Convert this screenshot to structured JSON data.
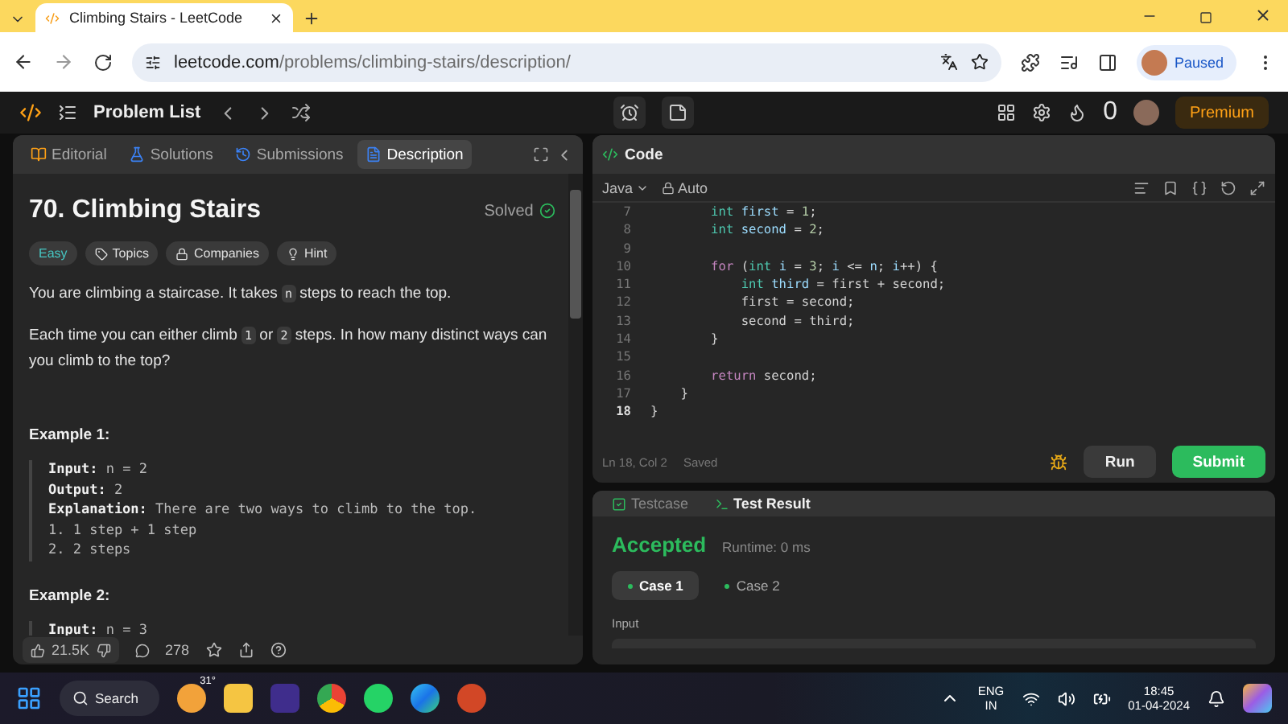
{
  "browser": {
    "tab_title": "Climbing Stairs - LeetCode",
    "url_host": "leetcode.com",
    "url_path": "/problems/climbing-stairs/description/",
    "profile": "Paused"
  },
  "nav": {
    "problem_list": "Problem List",
    "streak": "0",
    "premium": "Premium"
  },
  "left_tabs": [
    {
      "label": "Editorial",
      "selected": false
    },
    {
      "label": "Solutions",
      "selected": false
    },
    {
      "label": "Submissions",
      "selected": false
    },
    {
      "label": "Description",
      "selected": true
    }
  ],
  "problem": {
    "title": "70. Climbing Stairs",
    "status": "Solved",
    "difficulty": "Easy",
    "tags": [
      "Topics",
      "Companies",
      "Hint"
    ],
    "paragraphs": [
      [
        {
          "kind": "text",
          "text": "You are climbing a staircase. It takes "
        },
        {
          "kind": "code",
          "text": "n"
        },
        {
          "kind": "text",
          "text": " steps to reach the top."
        }
      ],
      [
        {
          "kind": "text",
          "text": "Each time you can either climb "
        },
        {
          "kind": "code",
          "text": "1"
        },
        {
          "kind": "text",
          "text": " or "
        },
        {
          "kind": "code",
          "text": "2"
        },
        {
          "kind": "text",
          "text": " steps. In how many distinct ways can you climb to the top?"
        }
      ]
    ],
    "examples": [
      {
        "title": "Example 1:",
        "lines": [
          {
            "label": "Input:",
            "value": "n = 2"
          },
          {
            "label": "Output:",
            "value": "2"
          },
          {
            "label": "Explanation:",
            "value": "There are two ways to climb to the top."
          },
          {
            "value": "1. 1 step + 1 step"
          },
          {
            "value": "2. 2 steps"
          }
        ]
      },
      {
        "title": "Example 2:",
        "lines": [
          {
            "label": "Input:",
            "value": "n = 3"
          }
        ]
      }
    ],
    "likes": "21.5K",
    "comments": "278"
  },
  "code_panel": {
    "title": "Code",
    "language": "Java",
    "mode": "Auto",
    "lines": [
      {
        "number": "7",
        "current": false,
        "segments": [
          {
            "kind": "type",
            "text": "        int"
          },
          {
            "kind": "var",
            "text": " first"
          },
          {
            "kind": "plain",
            "text": " = "
          },
          {
            "kind": "num",
            "text": "1"
          },
          {
            "kind": "plain",
            "text": ";"
          }
        ]
      },
      {
        "number": "8",
        "current": false,
        "segments": [
          {
            "kind": "type",
            "text": "        int"
          },
          {
            "kind": "var",
            "text": " second"
          },
          {
            "kind": "plain",
            "text": " = "
          },
          {
            "kind": "num",
            "text": "2"
          },
          {
            "kind": "plain",
            "text": ";"
          }
        ]
      },
      {
        "number": "9",
        "current": false
      },
      {
        "number": "10",
        "current": false,
        "segments": [
          {
            "kind": "keyword",
            "text": "        for"
          },
          {
            "kind": "plain",
            "text": " ("
          },
          {
            "kind": "type",
            "text": "int"
          },
          {
            "kind": "var",
            "text": " i"
          },
          {
            "kind": "plain",
            "text": " = "
          },
          {
            "kind": "num",
            "text": "3"
          },
          {
            "kind": "plain",
            "text": "; "
          },
          {
            "kind": "var",
            "text": "i"
          },
          {
            "kind": "plain",
            "text": " <= "
          },
          {
            "kind": "var",
            "text": "n"
          },
          {
            "kind": "plain",
            "text": "; "
          },
          {
            "kind": "var",
            "text": "i"
          },
          {
            "kind": "plain",
            "text": "++) {"
          }
        ]
      },
      {
        "number": "11",
        "current": false,
        "segments": [
          {
            "kind": "type",
            "text": "            int"
          },
          {
            "kind": "var",
            "text": " third"
          },
          {
            "kind": "plain",
            "text": " = first + second;"
          }
        ]
      },
      {
        "number": "12",
        "current": false,
        "segments": [
          {
            "kind": "plain",
            "text": "            first = second;"
          }
        ]
      },
      {
        "number": "13",
        "current": false,
        "segments": [
          {
            "kind": "plain",
            "text": "            second = third;"
          }
        ]
      },
      {
        "number": "14",
        "current": false,
        "segments": [
          {
            "kind": "plain",
            "text": "        }"
          }
        ]
      },
      {
        "number": "15",
        "current": false
      },
      {
        "number": "16",
        "current": false,
        "segments": [
          {
            "kind": "keyword",
            "text": "        return"
          },
          {
            "kind": "plain",
            "text": " second;"
          }
        ]
      },
      {
        "number": "17",
        "current": false,
        "segments": [
          {
            "kind": "plain",
            "text": "    }"
          }
        ]
      },
      {
        "number": "18",
        "current": true,
        "segments": [
          {
            "kind": "plain",
            "text": "}"
          }
        ]
      }
    ],
    "cursor": "Ln 18, Col 2",
    "save_state": "Saved",
    "run": "Run",
    "submit": "Submit"
  },
  "result_panel": {
    "tabs": [
      {
        "label": "Testcase",
        "selected": false
      },
      {
        "label": "Test Result",
        "selected": true
      }
    ],
    "verdict": "Accepted",
    "runtime": "Runtime: 0 ms",
    "cases": [
      {
        "label": "Case 1",
        "selected": true
      },
      {
        "label": "Case 2",
        "selected": false
      }
    ],
    "input_label": "Input"
  },
  "taskbar": {
    "search": "Search",
    "temperature": "31°",
    "language": "ENG",
    "region": "IN",
    "time": "18:45",
    "date": "01-04-2024"
  }
}
